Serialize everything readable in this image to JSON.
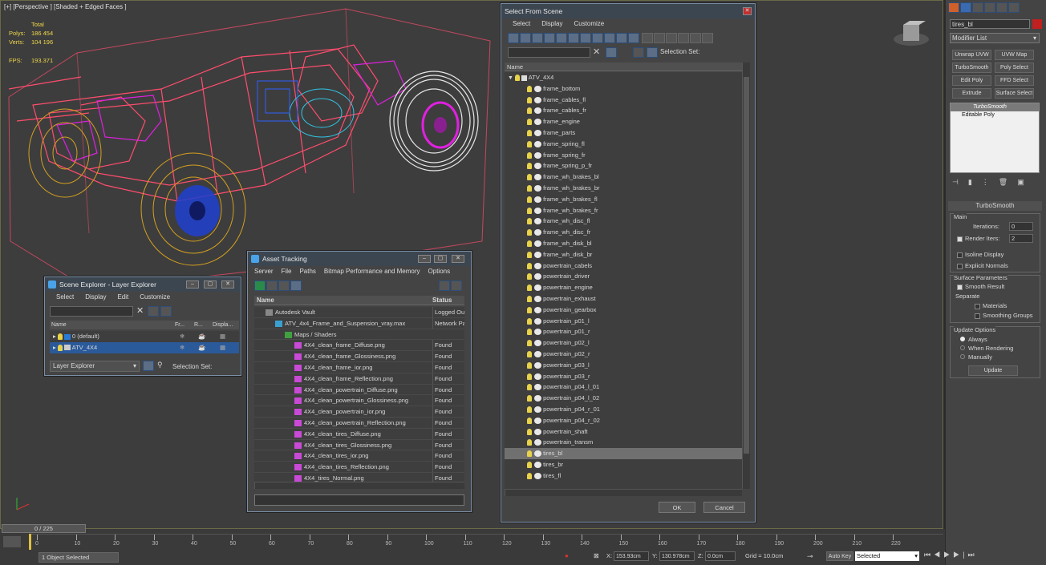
{
  "viewport": {
    "label": "[+] [Perspective ] [Shaded + Edged Faces ]",
    "stats": {
      "total_label": "Total",
      "polys_label": "Polys:",
      "polys_value": "186 454",
      "verts_label": "Verts:",
      "verts_value": "104 196",
      "fps_label": "FPS:",
      "fps_value": "193.371"
    }
  },
  "select_from_scene": {
    "title": "Select From Scene",
    "menu": [
      "Select",
      "Display",
      "Customize"
    ],
    "selection_set_label": "Selection Set:",
    "col_name": "Name",
    "root": "ATV_4X4",
    "items": [
      "frame_bottom",
      "frame_cables_fl",
      "frame_cables_fr",
      "frame_engine",
      "frame_parts",
      "frame_spring_fl",
      "frame_spring_fr",
      "frame_spring_p_fr",
      "frame_wh_brakes_bl",
      "frame_wh_brakes_br",
      "frame_wh_brakes_fl",
      "frame_wh_brakes_fr",
      "frame_wh_disc_fl",
      "frame_wh_disc_fr",
      "frame_wh_disk_bl",
      "frame_wh_disk_br",
      "powertrain_cabels",
      "powertrain_driver",
      "powertrain_engine",
      "powertrain_exhaust",
      "powertrain_gearbox",
      "powertrain_p01_l",
      "powertrain_p01_r",
      "powertrain_p02_l",
      "powertrain_p02_r",
      "powertrain_p03_l",
      "powertrain_p03_r",
      "powertrain_p04_l_01",
      "powertrain_p04_l_02",
      "powertrain_p04_r_01",
      "powertrain_p04_r_02",
      "powertrain_shaft",
      "powertrain_transm",
      "tires_bl",
      "tires_br",
      "tires_fl"
    ],
    "selected": "tires_bl",
    "ok": "OK",
    "cancel": "Cancel"
  },
  "asset_tracking": {
    "title": "Asset Tracking",
    "menu": [
      "Server",
      "File",
      "Paths",
      "Bitmap Performance and Memory",
      "Options"
    ],
    "col_name": "Name",
    "col_status": "Status",
    "rows": [
      {
        "name": "Autodesk Vault",
        "status": "Logged Ou",
        "level": 1,
        "icon": "vault"
      },
      {
        "name": "ATV_4x4_Frame_and_Suspension_vray.max",
        "status": "Network Pa",
        "level": 2,
        "icon": "max"
      },
      {
        "name": "Maps / Shaders",
        "status": "",
        "level": 3,
        "icon": "maps"
      },
      {
        "name": "4X4_clean_frame_Diffuse.png",
        "status": "Found",
        "level": 4,
        "icon": "png"
      },
      {
        "name": "4X4_clean_frame_Glossiness.png",
        "status": "Found",
        "level": 4,
        "icon": "png"
      },
      {
        "name": "4X4_clean_frame_ior.png",
        "status": "Found",
        "level": 4,
        "icon": "png"
      },
      {
        "name": "4X4_clean_frame_Reflection.png",
        "status": "Found",
        "level": 4,
        "icon": "png"
      },
      {
        "name": "4X4_clean_powertrain_Diffuse.png",
        "status": "Found",
        "level": 4,
        "icon": "png"
      },
      {
        "name": "4X4_clean_powertrain_Glossiness.png",
        "status": "Found",
        "level": 4,
        "icon": "png"
      },
      {
        "name": "4X4_clean_powertrain_ior.png",
        "status": "Found",
        "level": 4,
        "icon": "png"
      },
      {
        "name": "4X4_clean_powertrain_Reflection.png",
        "status": "Found",
        "level": 4,
        "icon": "png"
      },
      {
        "name": "4X4_clean_tires_Diffuse.png",
        "status": "Found",
        "level": 4,
        "icon": "png"
      },
      {
        "name": "4X4_clean_tires_Glossiness.png",
        "status": "Found",
        "level": 4,
        "icon": "png"
      },
      {
        "name": "4X4_clean_tires_ior.png",
        "status": "Found",
        "level": 4,
        "icon": "png"
      },
      {
        "name": "4X4_clean_tires_Reflection.png",
        "status": "Found",
        "level": 4,
        "icon": "png"
      },
      {
        "name": "4X4_tires_Normal.png",
        "status": "Found",
        "level": 4,
        "icon": "png"
      }
    ]
  },
  "scene_explorer": {
    "title": "Scene Explorer - Layer Explorer",
    "menu": [
      "Select",
      "Display",
      "Edit",
      "Customize"
    ],
    "col_name": "Name",
    "col_fr": "Fr...",
    "col_r": "R...",
    "col_disp": "Displa...",
    "layers": [
      "0 (default)",
      "ATV_4X4"
    ],
    "bottom_dropdown": "Layer Explorer",
    "selection_set_label": "Selection Set:"
  },
  "command_panel": {
    "object_name": "tires_bl",
    "modifier_list": "Modifier List",
    "buttons": [
      "Unwrap UVW",
      "UVW Map",
      "TurboSmooth",
      "Poly Select",
      "Edit Poly",
      "FFD Select",
      "Extrude",
      "Surface Select"
    ],
    "stack": [
      "TurboSmooth",
      "Editable Poly"
    ],
    "rollout_title": "TurboSmooth",
    "main_label": "Main",
    "iterations_label": "Iterations:",
    "iterations_value": "0",
    "render_iters_label": "Render Iters:",
    "render_iters_value": "2",
    "isoline": "Isoline Display",
    "explicit": "Explicit Normals",
    "surface_params": "Surface Parameters",
    "smooth_result": "Smooth Result",
    "separate": "Separate",
    "materials": "Materials",
    "smoothing_groups": "Smoothing Groups",
    "update_options": "Update Options",
    "always": "Always",
    "when_rendering": "When Rendering",
    "manually": "Manually",
    "update_btn": "Update"
  },
  "timeline": {
    "frame": "0 / 225",
    "ticks": [
      "0",
      "10",
      "20",
      "30",
      "40",
      "50",
      "60",
      "70",
      "80",
      "90",
      "100",
      "110",
      "120",
      "130",
      "140",
      "150",
      "160",
      "170",
      "180",
      "190",
      "200",
      "210",
      "220"
    ]
  },
  "status": {
    "selected": "1 Object Selected",
    "x_label": "X:",
    "x_value": "153.93cm",
    "y_label": "Y:",
    "y_value": "130.978cm",
    "z_label": "Z:",
    "z_value": "0.0cm",
    "grid": "Grid = 10.0cm",
    "autokey": "Auto Key",
    "selected_dropdown": "Selected"
  },
  "colors": {
    "accent": "#4a8fd6",
    "wire_frame": "#ff4d6d",
    "wire_tire": "#e8e8e8",
    "wire_yellow": "#d4a020",
    "wire_magenta": "#e020e0",
    "wire_blue": "#3060ff"
  }
}
